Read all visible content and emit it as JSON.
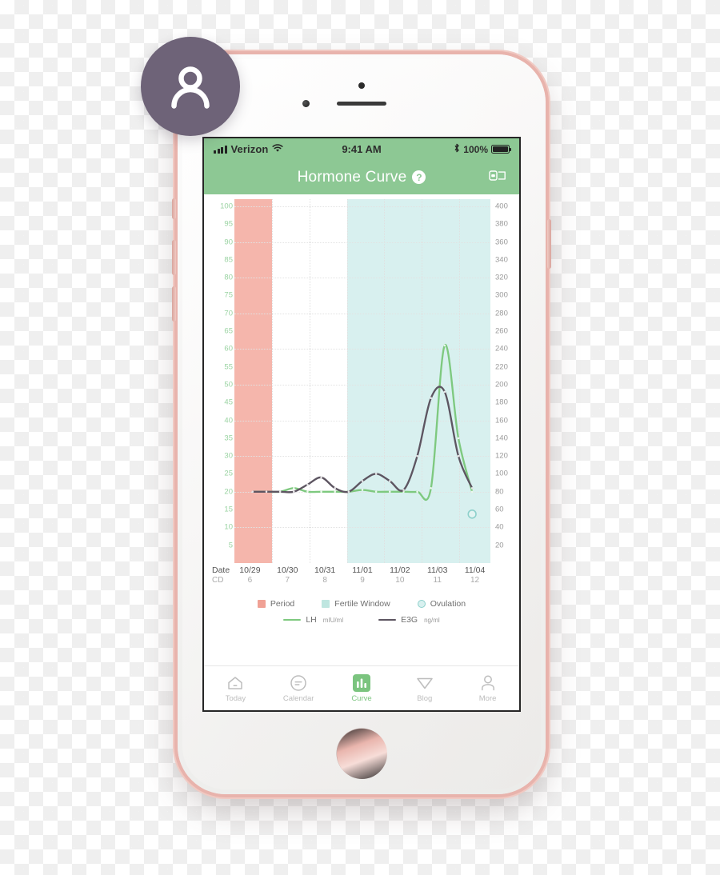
{
  "status_bar": {
    "carrier": "Verizon",
    "time": "9:41 AM",
    "battery_pct": "100%",
    "signal_icon": "cellular-bars-icon",
    "wifi_icon": "wifi-icon",
    "bluetooth_icon": "bluetooth-icon",
    "battery_icon": "battery-full-icon"
  },
  "nav_bar": {
    "title": "Hormone Curve",
    "help_label": "?",
    "help_icon": "question-mark-badge-icon",
    "rotate_icon": "rotate-landscape-icon",
    "background": "#8dc894"
  },
  "chart_data": {
    "type": "line",
    "title": "Hormone Curve",
    "x": [
      "10/29",
      "10/30",
      "10/31",
      "11/01",
      "11/02",
      "11/03",
      "11/04"
    ],
    "cycle_days": [
      "6",
      "7",
      "8",
      "9",
      "10",
      "11",
      "12"
    ],
    "x_header": {
      "date_label": "Date",
      "cd_label": "CD"
    },
    "grid": true,
    "legend_position": "bottom",
    "axes": {
      "left": {
        "label": "LH mIU/ml",
        "ticks": [
          100,
          95,
          90,
          85,
          80,
          75,
          70,
          65,
          60,
          55,
          50,
          45,
          40,
          35,
          30,
          25,
          20,
          15,
          10,
          5
        ],
        "ylim": [
          0,
          102
        ],
        "color": "#9ad3a2"
      },
      "right": {
        "label": "E3G ng/ml",
        "ticks": [
          400,
          380,
          360,
          340,
          320,
          300,
          280,
          260,
          240,
          220,
          200,
          180,
          160,
          140,
          120,
          100,
          80,
          60,
          40,
          20
        ],
        "ylim": [
          0,
          408
        ],
        "color": "#9a9a9a"
      }
    },
    "series": [
      {
        "name": "LH",
        "unit": "mIU/ml",
        "color": "#7ec97f",
        "axis": "left",
        "values": [
          20,
          20,
          20,
          21,
          20,
          20,
          20,
          20,
          20.5,
          20,
          20,
          20,
          20,
          21,
          61,
          35,
          20
        ]
      },
      {
        "name": "E3G",
        "unit": "ng/ml",
        "color": "#5d5561",
        "axis": "right",
        "values": [
          80,
          80,
          80,
          80,
          88,
          96,
          84,
          80,
          92,
          100,
          92,
          82,
          120,
          185,
          192,
          120,
          84
        ]
      }
    ],
    "bands": [
      {
        "name": "Period",
        "color": "#f5b6ac",
        "start_x": "10/29",
        "end_x": "10/29"
      },
      {
        "name": "Fertile Window",
        "color": "#d8f0ef",
        "start_x": "11/01",
        "end_x": "11/04"
      }
    ],
    "markers": [
      {
        "name": "Ovulation",
        "color": "#8dd0cb",
        "x": "11/04",
        "series": "LH"
      }
    ]
  },
  "legend": {
    "row1": [
      {
        "label": "Period",
        "swatch": "square",
        "color": "#f0a195",
        "icon": "period-swatch-icon"
      },
      {
        "label": "Fertile Window",
        "swatch": "square",
        "color": "#bfe6e0",
        "icon": "fertile-window-swatch-icon"
      },
      {
        "label": "Ovulation",
        "swatch": "ring",
        "color": "#8dd0cb",
        "icon": "ovulation-ring-icon"
      }
    ],
    "row2": [
      {
        "label": "LH",
        "unit": "mIU/ml",
        "swatch": "line",
        "color": "#7ec97f",
        "icon": "lh-line-icon"
      },
      {
        "label": "E3G",
        "unit": "ng/ml",
        "swatch": "line",
        "color": "#5d5561",
        "icon": "e3g-line-icon"
      }
    ]
  },
  "tab_bar": {
    "items": [
      {
        "label": "Today",
        "icon": "home-icon",
        "active": false
      },
      {
        "label": "Calendar",
        "icon": "calendar-circle-icon",
        "active": false
      },
      {
        "label": "Curve",
        "icon": "bar-chart-icon",
        "active": true
      },
      {
        "label": "Blog",
        "icon": "paper-plane-icon",
        "active": false
      },
      {
        "label": "More",
        "icon": "person-icon",
        "active": false
      }
    ],
    "active_color": "#7bc47f",
    "inactive_color": "#bdbdbd"
  },
  "avatar": {
    "icon": "user-avatar-icon",
    "background": "#6e6378"
  },
  "device": {
    "frame_color": "#e8b3ac",
    "earpiece_icon": "earpiece-speaker-icon",
    "camera_icon": "front-camera-icon",
    "sensor_icon": "proximity-sensor-icon",
    "home_button_icon": "home-button-icon"
  }
}
